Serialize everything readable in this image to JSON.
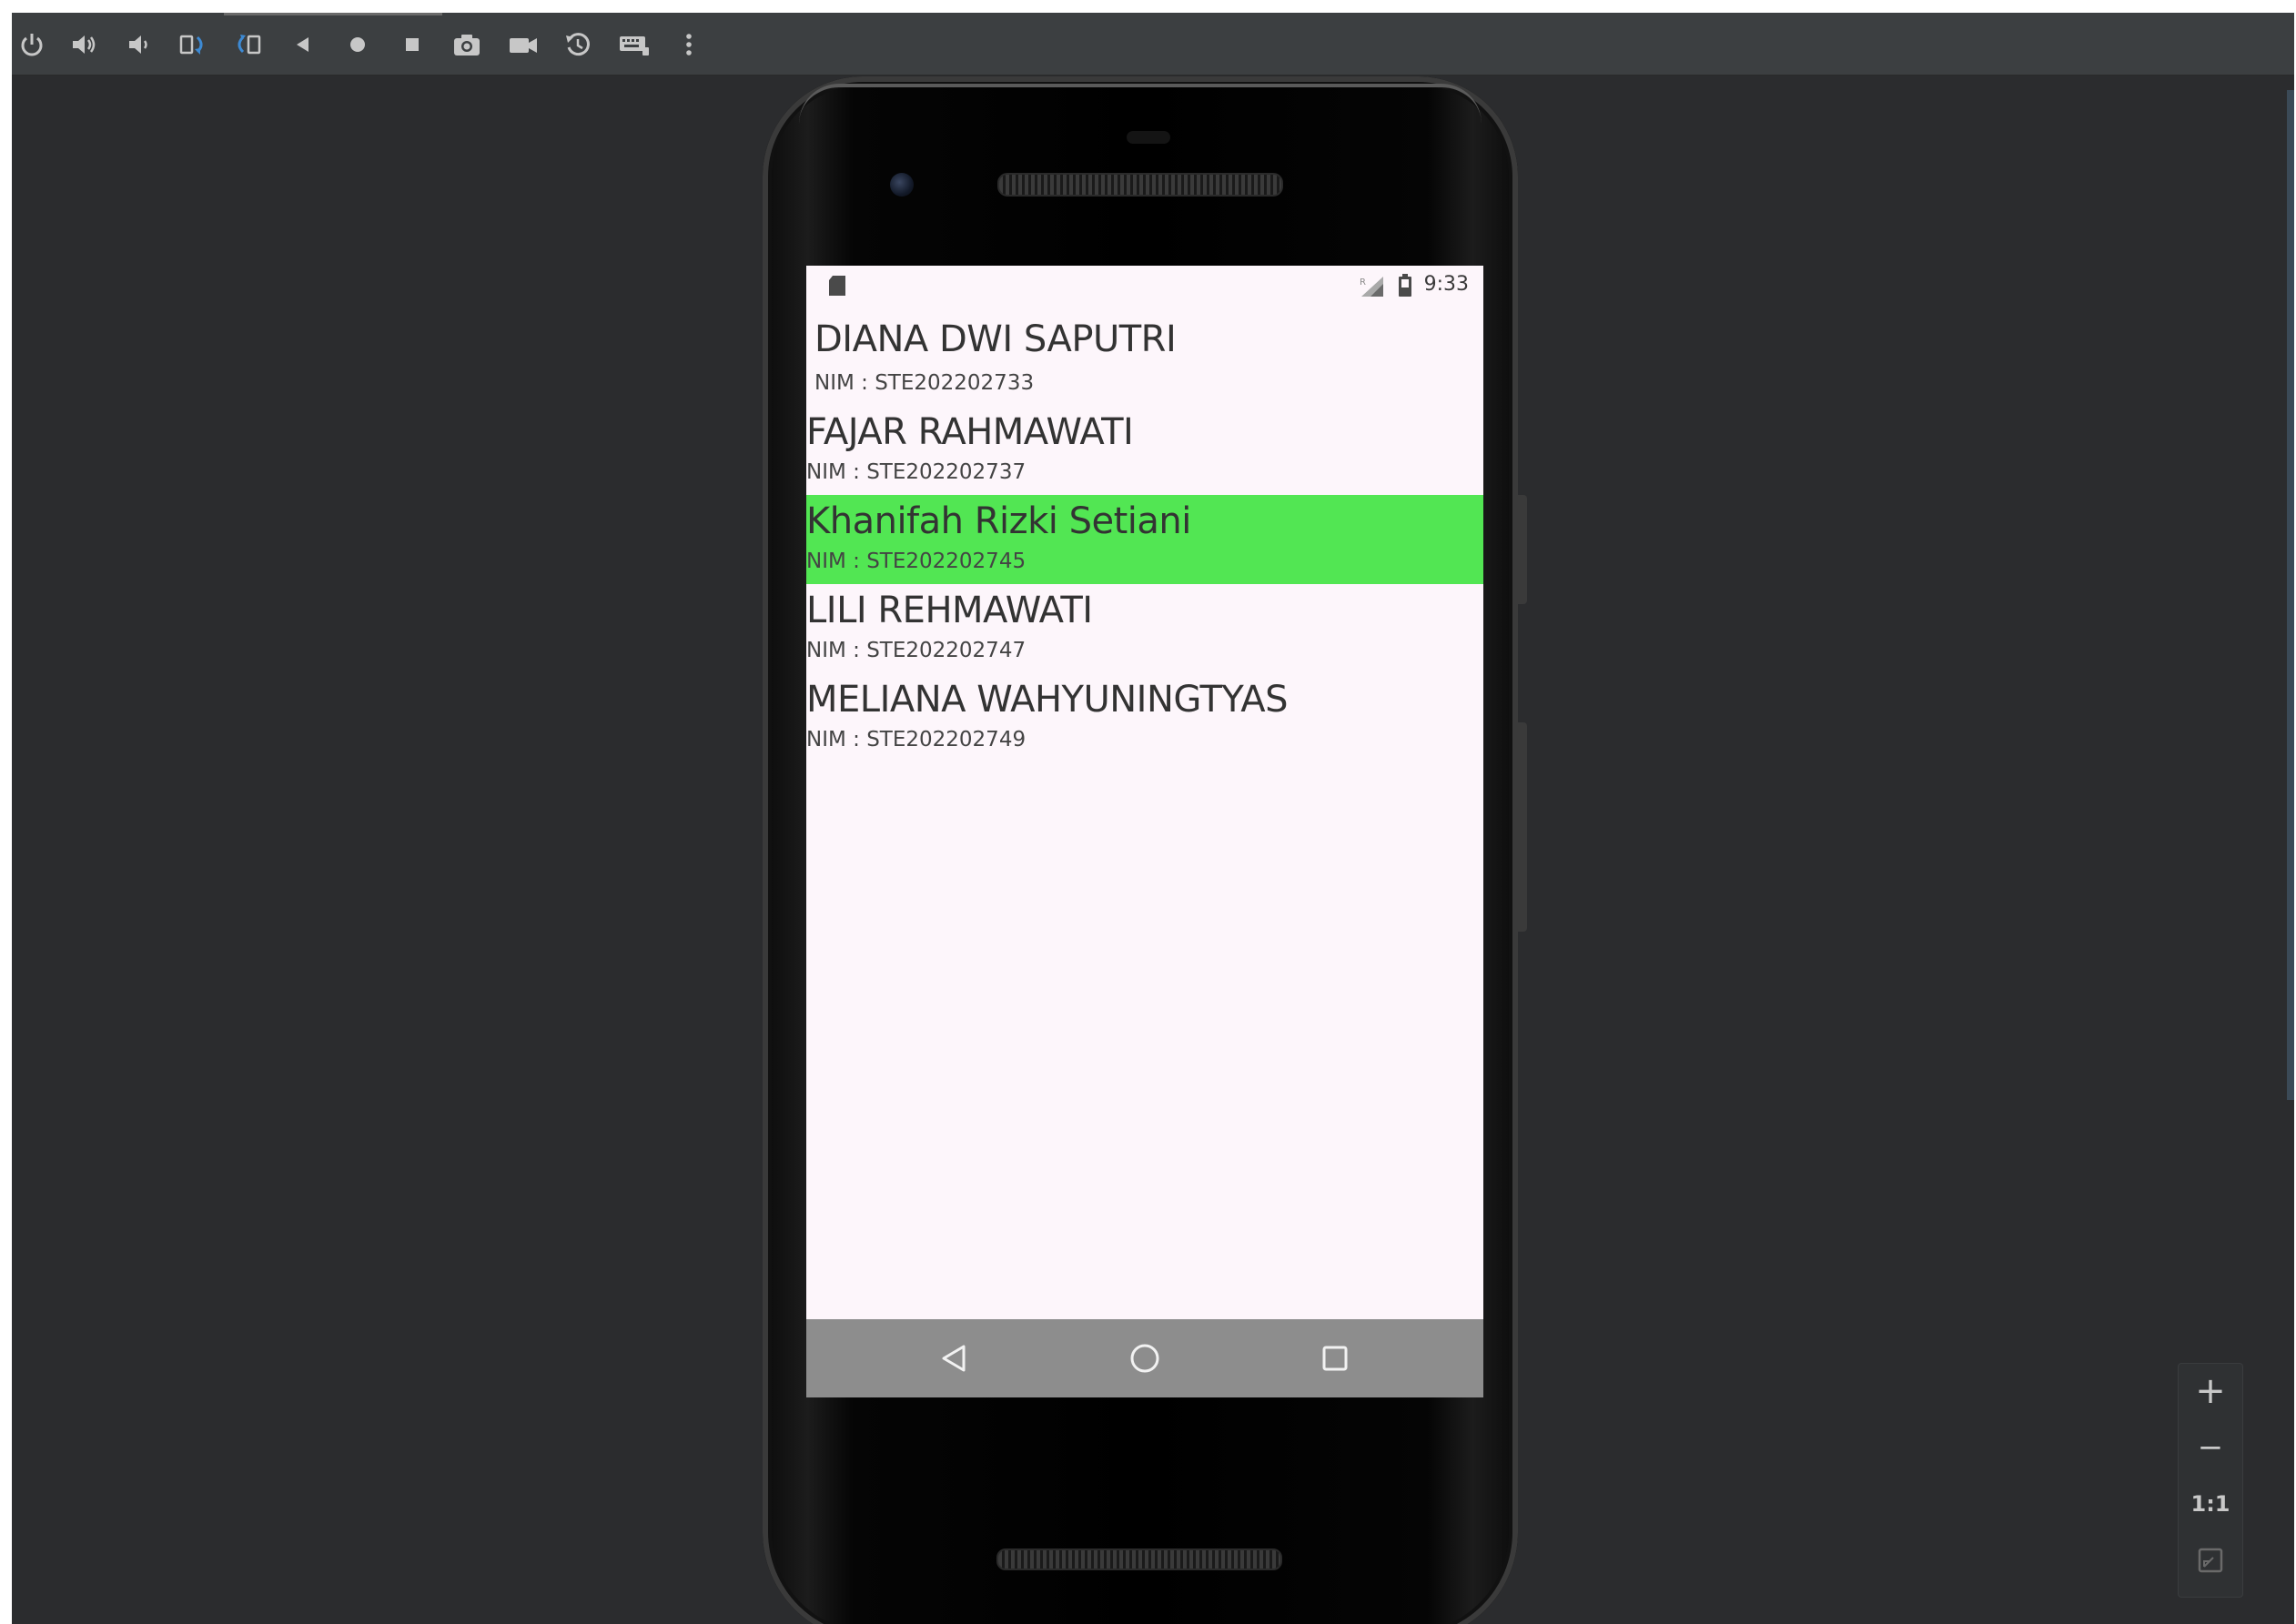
{
  "toolbar": {
    "buttons": [
      {
        "name": "power-button",
        "icon": "power-icon"
      },
      {
        "name": "volume-up-button",
        "icon": "volume-up-icon"
      },
      {
        "name": "volume-down-button",
        "icon": "volume-down-icon"
      },
      {
        "name": "rotate-left-button",
        "icon": "rotate-left-icon"
      },
      {
        "name": "rotate-right-button",
        "icon": "rotate-right-icon"
      },
      {
        "name": "back-button",
        "icon": "back-triangle-icon"
      },
      {
        "name": "home-button",
        "icon": "home-dot-icon"
      },
      {
        "name": "overview-button",
        "icon": "overview-square-icon"
      },
      {
        "name": "screenshot-button",
        "icon": "camera-icon"
      },
      {
        "name": "screen-record-button",
        "icon": "video-camera-icon"
      },
      {
        "name": "snapshot-button",
        "icon": "history-icon"
      },
      {
        "name": "keyboard-button",
        "icon": "keyboard-icon"
      },
      {
        "name": "more-button",
        "icon": "more-vertical-icon"
      }
    ]
  },
  "device": {
    "status_bar": {
      "time": "9:33"
    },
    "students": [
      {
        "name": "DIANA DWI SAPUTRI",
        "nim": "NIM : STE202202733",
        "selected": false
      },
      {
        "name": "FAJAR RAHMAWATI",
        "nim": "NIM : STE202202737",
        "selected": false
      },
      {
        "name": "Khanifah Rizki Setiani",
        "nim": "NIM : STE202202745",
        "selected": true
      },
      {
        "name": "LILI REHMAWATI",
        "nim": "NIM : STE202202747",
        "selected": false
      },
      {
        "name": "MELIANA WAHYUNINGTYAS",
        "nim": "NIM : STE202202749",
        "selected": false
      }
    ],
    "nav": {
      "back_icon": "nav-back-icon",
      "home_icon": "nav-home-icon",
      "recents_icon": "nav-recents-icon"
    }
  },
  "zoom": {
    "zoom_in": "+",
    "zoom_out": "−",
    "actual_size": "1:1",
    "fit_icon": "fit-screen-icon"
  },
  "colors": {
    "selected_row": "#52e653",
    "screen_background": "#fdf6fb",
    "emulator_background": "#2b2c2e",
    "toolbar_background": "#3c3f41",
    "nav_bar": "#8d8d8d",
    "toolbar_icon_blue": "#3d8ad4"
  }
}
